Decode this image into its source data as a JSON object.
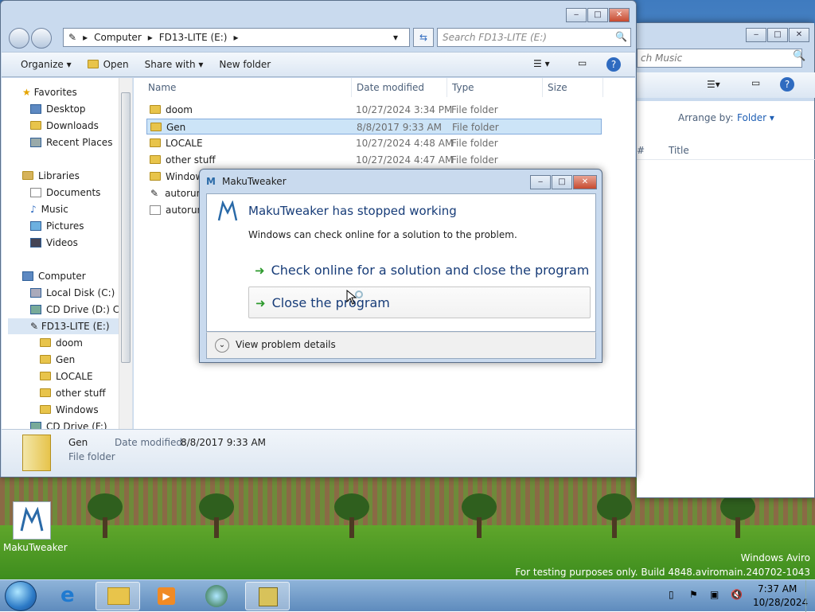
{
  "desktop": {
    "watermark_line1": "Windows Aviro",
    "watermark_line2": "For testing purposes only. Build 4848.aviromain.240702-1043",
    "icon_label": "MakuTweaker"
  },
  "music_window": {
    "search_placeholder": "ch Music",
    "arrange_label": "Arrange by:",
    "arrange_value": "Folder",
    "col_number": "#",
    "col_title": "Title"
  },
  "explorer": {
    "breadcrumb": [
      "Computer",
      "FD13-LITE (E:)"
    ],
    "search_placeholder": "Search FD13-LITE (E:)",
    "toolbar": {
      "organize": "Organize",
      "open": "Open",
      "share_with": "Share with",
      "new_folder": "New folder"
    },
    "nav": {
      "favorites": "Favorites",
      "desktop": "Desktop",
      "downloads": "Downloads",
      "recent_places": "Recent Places",
      "libraries": "Libraries",
      "documents": "Documents",
      "music": "Music",
      "pictures": "Pictures",
      "videos": "Videos",
      "computer": "Computer",
      "local_disk": "Local Disk (C:)",
      "cd_drive_d": "CD Drive (D:) CCC",
      "fd13": "FD13-LITE (E:)",
      "sub": [
        "doom",
        "Gen",
        "LOCALE",
        "other stuff",
        "Windows"
      ],
      "cd_drive_f": "CD Drive (F:)"
    },
    "columns": {
      "name": "Name",
      "date": "Date modified",
      "type": "Type",
      "size": "Size"
    },
    "files": [
      {
        "name": "doom",
        "date": "10/27/2024 3:34 PM",
        "type": "File folder"
      },
      {
        "name": "Gen",
        "date": "8/8/2017 9:33 AM",
        "type": "File folder"
      },
      {
        "name": "LOCALE",
        "date": "10/27/2024 4:48 AM",
        "type": "File folder"
      },
      {
        "name": "other stuff",
        "date": "10/27/2024 4:47 AM",
        "type": "File folder"
      },
      {
        "name": "Window",
        "date": "",
        "type": ""
      },
      {
        "name": "autorun",
        "date": "",
        "type": ""
      },
      {
        "name": "autorun",
        "date": "",
        "type": ""
      }
    ],
    "details": {
      "name": "Gen",
      "date_label": "Date modified:",
      "date_value": "8/8/2017 9:33 AM",
      "type": "File folder"
    }
  },
  "dialog": {
    "title": "MakuTweaker",
    "heading": "MakuTweaker has stopped working",
    "message": "Windows can check online for a solution to the problem.",
    "option1": "Check online for a solution and close the program",
    "option2": "Close the program",
    "details": "View problem details"
  },
  "taskbar": {
    "time": "7:37 AM",
    "date": "10/28/2024"
  }
}
